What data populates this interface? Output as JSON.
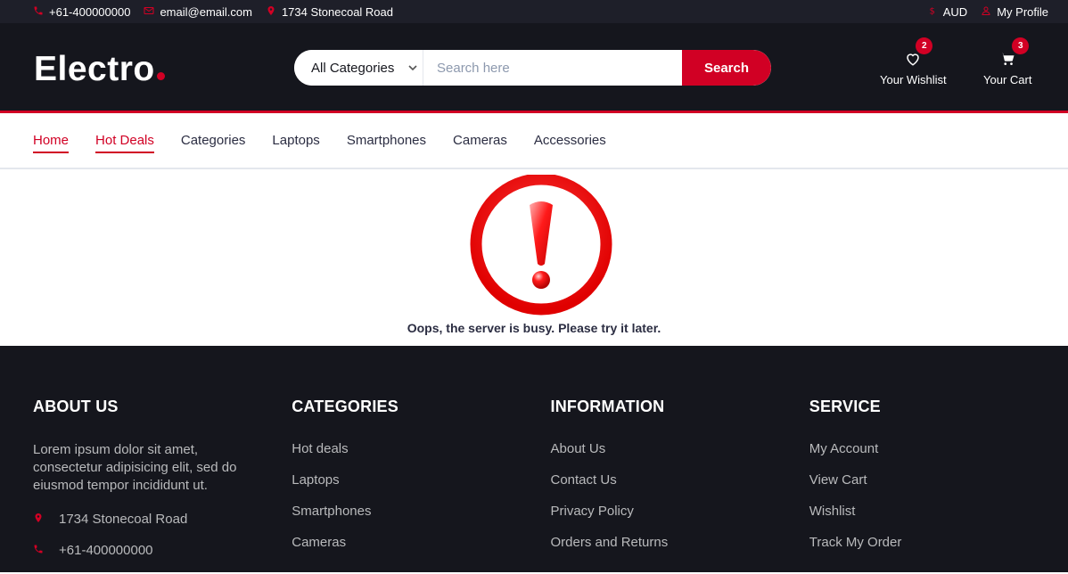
{
  "topbar": {
    "phone": "+61-400000000",
    "email": "email@email.com",
    "address": "1734 Stonecoal Road",
    "currency": "AUD",
    "profile": "My Profile"
  },
  "header": {
    "logo": "Electro",
    "category": "All Categories",
    "search_placeholder": "Search here",
    "search_button": "Search",
    "wishlist_label": "Your Wishlist",
    "wishlist_count": "2",
    "cart_label": "Your Cart",
    "cart_count": "3"
  },
  "nav": {
    "items": [
      {
        "label": "Home"
      },
      {
        "label": "Hot Deals"
      },
      {
        "label": "Categories"
      },
      {
        "label": "Laptops"
      },
      {
        "label": "Smartphones"
      },
      {
        "label": "Cameras"
      },
      {
        "label": "Accessories"
      }
    ]
  },
  "main": {
    "error_message": "Oops, the server is busy. Please try it later."
  },
  "footer": {
    "about": {
      "title": "ABOUT US",
      "text": "Lorem ipsum dolor sit amet, consectetur adipisicing elit, sed do eiusmod tempor incididunt ut.",
      "address": "1734 Stonecoal Road",
      "phone": "+61-400000000"
    },
    "categories": {
      "title": "CATEGORIES",
      "links": [
        "Hot deals",
        "Laptops",
        "Smartphones",
        "Cameras"
      ]
    },
    "information": {
      "title": "INFORMATION",
      "links": [
        "About Us",
        "Contact Us",
        "Privacy Policy",
        "Orders and Returns"
      ]
    },
    "service": {
      "title": "SERVICE",
      "links": [
        "My Account",
        "View Cart",
        "Wishlist",
        "Track My Order"
      ]
    }
  },
  "colors": {
    "accent": "#d10024",
    "header_bg": "#15161d",
    "topbar_bg": "#1e1f29"
  }
}
